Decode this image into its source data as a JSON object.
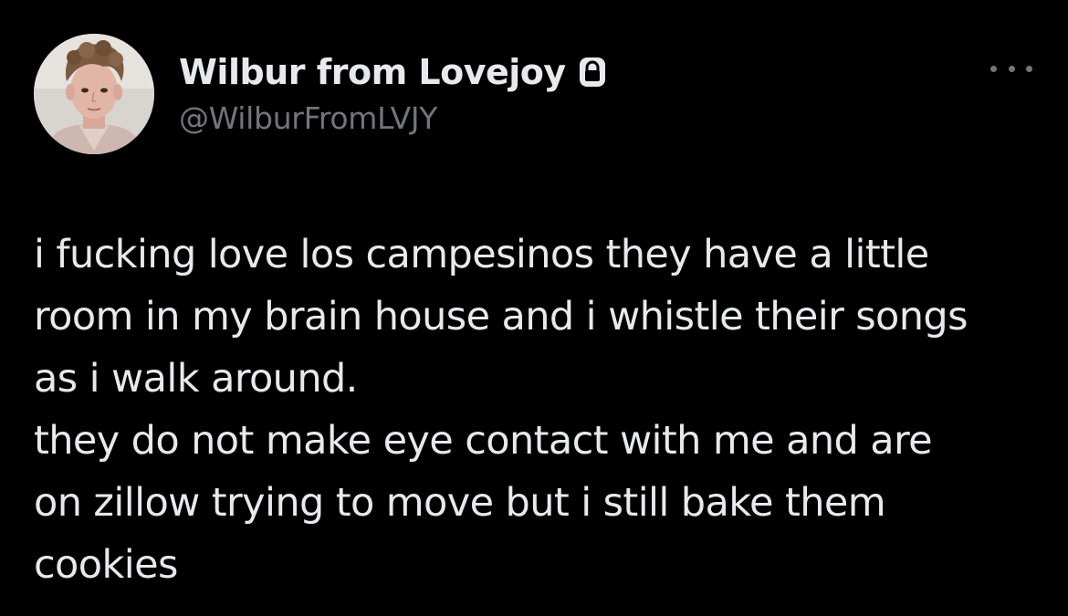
{
  "author": {
    "display_name": "Wilbur from Lovejoy",
    "handle": "@WilburFromLVJY",
    "protected_icon": "lock-icon",
    "avatar": "profile-photo"
  },
  "menu": {
    "icon": "more-options-icon"
  },
  "tweet": {
    "lines": [
      "i fucking love los campesinos they have a little",
      "room in my brain house and i whistle their songs",
      "as i walk around.",
      "they do not make eye contact with me and are",
      "on zillow trying to move but i still bake them",
      "cookies"
    ]
  },
  "colors": {
    "background": "#000000",
    "text_primary": "#e7e9ea",
    "text_secondary": "#71767b"
  }
}
